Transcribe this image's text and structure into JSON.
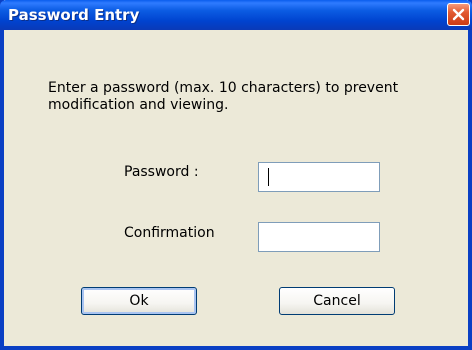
{
  "window": {
    "title": "Password Entry",
    "close_icon": "close-icon"
  },
  "message": "Enter a password (max. 10 characters) to prevent modification and viewing.",
  "form": {
    "password_label": "Password :",
    "password_value": "",
    "confirmation_label": "Confirmation",
    "confirmation_value": ""
  },
  "buttons": {
    "ok_label": "Ok",
    "cancel_label": "Cancel"
  },
  "colors": {
    "titlebar": "#0b5ce3",
    "window_bg": "#ece9d8",
    "close_button": "#e25a32"
  }
}
